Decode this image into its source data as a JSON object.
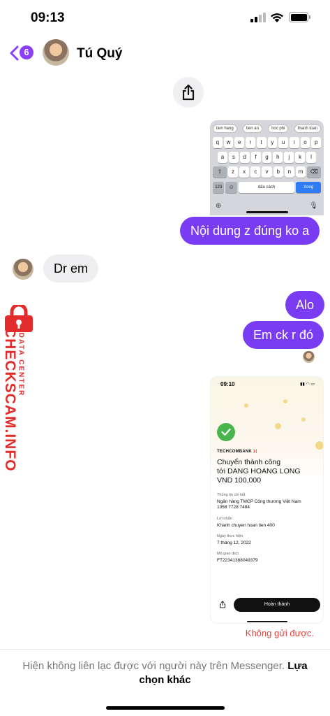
{
  "status_bar": {
    "time": "09:13"
  },
  "header": {
    "unread_count": "6",
    "contact_name": "Tú Quý"
  },
  "keyboard_screenshot": {
    "suggestions": [
      "tien hang",
      "tien an",
      "hoc phi",
      "thanh toan"
    ],
    "row1": [
      "q",
      "w",
      "e",
      "r",
      "t",
      "y",
      "u",
      "i",
      "o",
      "p"
    ],
    "row2": [
      "a",
      "s",
      "d",
      "f",
      "g",
      "h",
      "j",
      "k",
      "l"
    ],
    "row3": [
      "z",
      "x",
      "c",
      "v",
      "b",
      "n",
      "m"
    ],
    "numbers_key": "123",
    "space_label": "dấu cách",
    "done_label": "Xong"
  },
  "messages": {
    "m1": "Nội dung z đúng ko a",
    "m2": "Dr em",
    "m3": "Alo",
    "m4": "Em ck r đó"
  },
  "watermark": {
    "main": "CHECKSCAM.INFO",
    "sub": "DATA CENTER"
  },
  "receipt": {
    "time": "09:10",
    "bank": "TECHCOMBANK",
    "title_line1": "Chuyển thành công",
    "title_line2": "tới DANG HOANG LONG",
    "title_line3": "VND 100,000",
    "details_label": "Thông tin chi tiết",
    "details_bank": "Ngân hàng TMCP Công thương Việt Nam",
    "details_account": "1058 7728 7484",
    "message_label": "Lời nhắn",
    "message_value": "Khanh chuyen hoan tien 400",
    "date_label": "Ngày thực hiện",
    "date_value": "7 tháng 12, 2022",
    "txn_label": "Mã giao dịch",
    "txn_value": "FT22341388049379",
    "done_button": "Hoàn thành"
  },
  "send_error": "Không gửi được.",
  "footer": {
    "notice": "Hiện không liên lạc được với người này trên Messenger.",
    "link": "Lựa chọn khác"
  },
  "colors": {
    "accent": "#7a3cf2",
    "error": "#e0443e",
    "watermark": "#e22c2c"
  }
}
